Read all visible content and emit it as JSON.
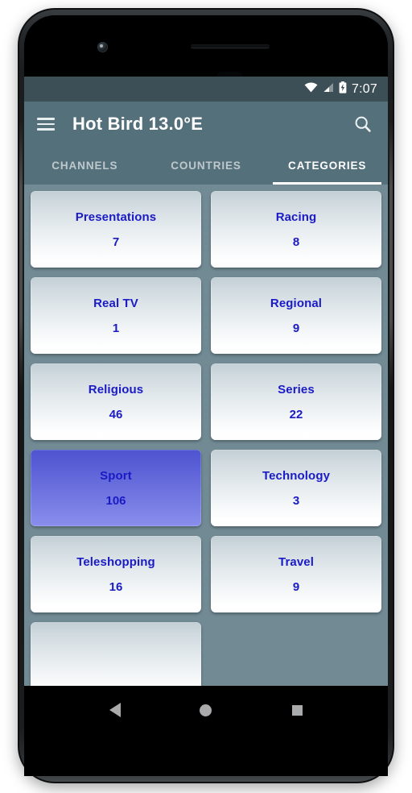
{
  "device": {
    "hardware": {
      "front_camera": "front-camera-icon",
      "earpiece": "earpiece-speaker-icon",
      "proximity_sensor": "proximity-sensor-icon"
    }
  },
  "status_bar": {
    "time": "7:07",
    "icons": [
      "wifi-icon",
      "cellular-signal-icon",
      "battery-charging-icon"
    ],
    "background_color": "#3c4e56"
  },
  "app_bar": {
    "menu_icon": "hamburger-menu-icon",
    "title": "Hot Bird 13.0°E",
    "search_icon": "search-icon",
    "background_color": "#54707a"
  },
  "tabs": {
    "active_index": 2,
    "items": [
      {
        "label": "CHANNELS"
      },
      {
        "label": "COUNTRIES"
      },
      {
        "label": "CATEGORIES"
      }
    ],
    "indicator_color": "#ffffff"
  },
  "content": {
    "background_color": "#718a94",
    "card_text_color": "#1b1bc6",
    "selected_card_color": "#5a5fd6",
    "cards": [
      {
        "title": "Presentations",
        "count": "7",
        "selected": false
      },
      {
        "title": "Racing",
        "count": "8",
        "selected": false
      },
      {
        "title": "Real TV",
        "count": "1",
        "selected": false
      },
      {
        "title": "Regional",
        "count": "9",
        "selected": false
      },
      {
        "title": "Religious",
        "count": "46",
        "selected": false
      },
      {
        "title": "Series",
        "count": "22",
        "selected": false
      },
      {
        "title": "Sport",
        "count": "106",
        "selected": true
      },
      {
        "title": "Technology",
        "count": "3",
        "selected": false
      },
      {
        "title": "Teleshopping",
        "count": "16",
        "selected": false
      },
      {
        "title": "Travel",
        "count": "9",
        "selected": false
      },
      {
        "title": "",
        "count": "",
        "selected": false
      }
    ]
  },
  "navigation_bar": {
    "buttons": [
      {
        "name": "back-icon"
      },
      {
        "name": "home-icon"
      },
      {
        "name": "recents-icon"
      }
    ],
    "background_color": "#000000"
  }
}
